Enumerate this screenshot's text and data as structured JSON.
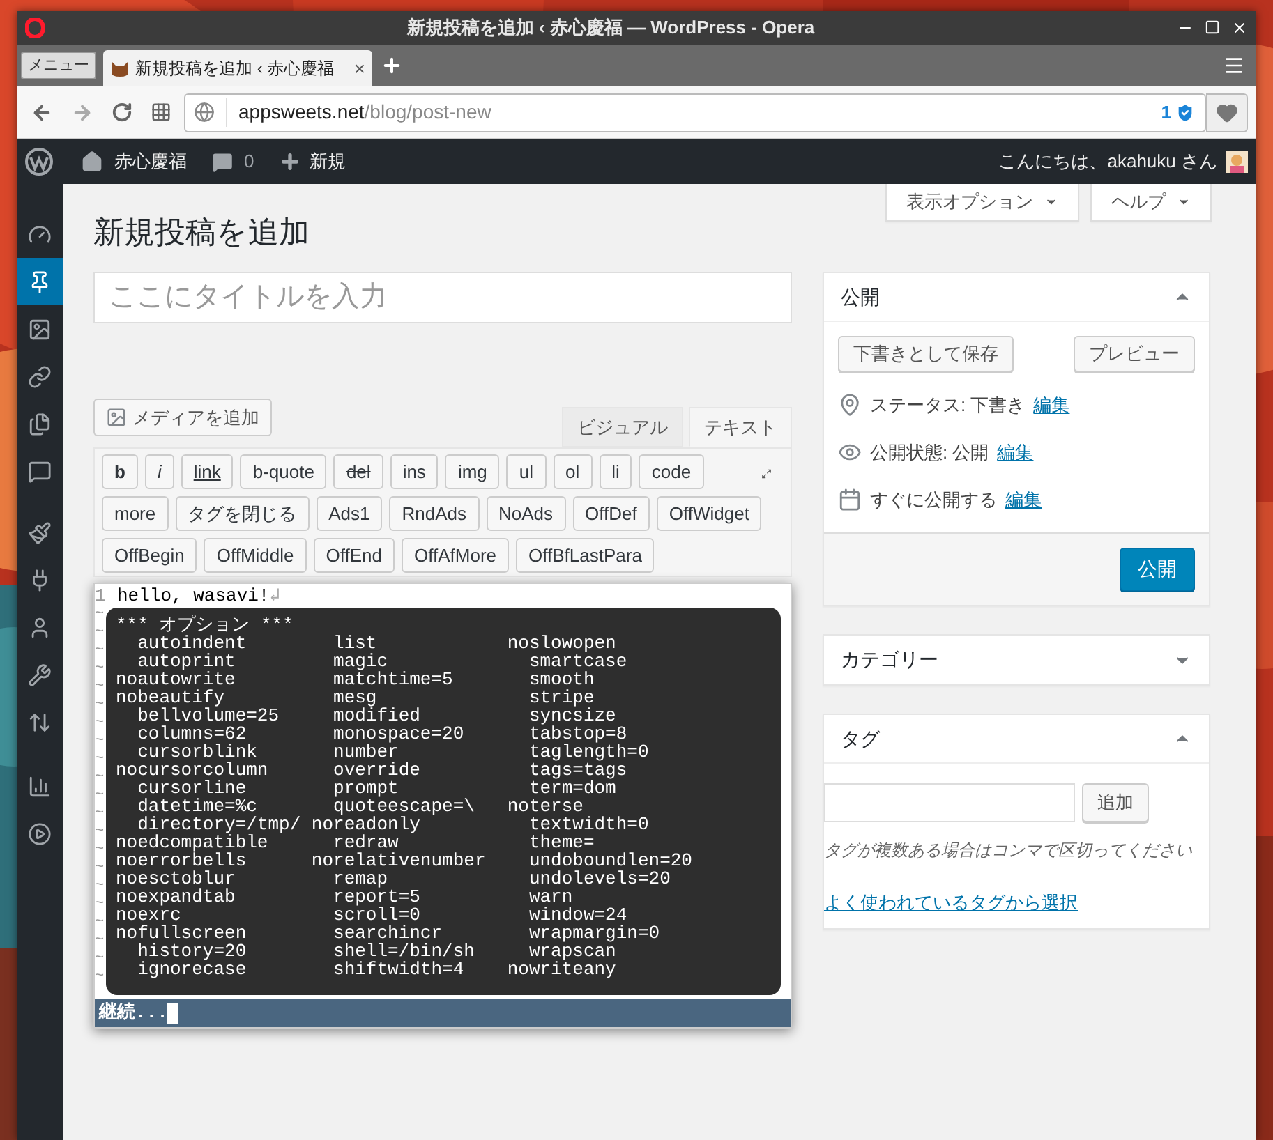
{
  "window": {
    "title": "新規投稿を追加 ‹ 赤心慶福 — WordPress - Opera"
  },
  "browser": {
    "menu_button": "メニュー",
    "tab": {
      "title": "新規投稿を追加 ‹ 赤心慶福",
      "close": "×",
      "selected": true
    },
    "address": {
      "host": "appsweets.net",
      "path": "/blog/post-new",
      "blocked_count": "1"
    }
  },
  "admin_bar": {
    "site": "赤心慶福",
    "comments": "0",
    "new": "新規",
    "greeting": "こんにちは、akahuku さん"
  },
  "admin_menu": [
    {
      "kind": "dashboard",
      "selected": false
    },
    {
      "kind": "posts",
      "selected": true
    },
    {
      "kind": "media",
      "selected": false
    },
    {
      "kind": "links",
      "selected": false
    },
    {
      "kind": "pages",
      "selected": false
    },
    {
      "kind": "comments",
      "selected": false
    },
    {
      "kind": "appearance",
      "selected": false
    },
    {
      "kind": "plugins",
      "selected": false
    },
    {
      "kind": "users",
      "selected": false
    },
    {
      "kind": "tools",
      "selected": false
    },
    {
      "kind": "settings",
      "selected": false
    },
    {
      "kind": "stats",
      "selected": false
    },
    {
      "kind": "video",
      "selected": false
    }
  ],
  "screen_tabs": [
    {
      "label": "表示オプション",
      "expanded": false
    },
    {
      "label": "ヘルプ",
      "expanded": false
    }
  ],
  "heading": "新規投稿を追加",
  "title_field": {
    "placeholder": "ここにタイトルを入力"
  },
  "media_button": "メディアを追加",
  "editor_tabs": [
    {
      "label": "ビジュアル",
      "selected": false
    },
    {
      "label": "テキスト",
      "selected": true
    }
  ],
  "quicktags": [
    [
      {
        "label": "b",
        "kind": "bold"
      },
      {
        "label": "i",
        "kind": "italic"
      },
      {
        "label": "link",
        "kind": "underline"
      },
      {
        "label": "b-quote",
        "kind": "plain"
      },
      {
        "label": "del",
        "kind": "strike"
      },
      {
        "label": "ins",
        "kind": "plain"
      },
      {
        "label": "img",
        "kind": "plain"
      },
      {
        "label": "ul",
        "kind": "plain"
      },
      {
        "label": "ol",
        "kind": "plain"
      },
      {
        "label": "li",
        "kind": "plain"
      },
      {
        "label": "code",
        "kind": "plain"
      }
    ],
    [
      {
        "label": "more",
        "kind": "plain"
      },
      {
        "label": "タグを閉じる",
        "kind": "plain"
      },
      {
        "label": "Ads1",
        "kind": "plain"
      },
      {
        "label": "RndAds",
        "kind": "plain"
      },
      {
        "label": "NoAds",
        "kind": "plain"
      },
      {
        "label": "OffDef",
        "kind": "plain"
      },
      {
        "label": "OffWidget",
        "kind": "plain"
      }
    ],
    [
      {
        "label": "OffBegin",
        "kind": "plain"
      },
      {
        "label": "OffMiddle",
        "kind": "plain"
      },
      {
        "label": "OffEnd",
        "kind": "plain"
      },
      {
        "label": "OffAfMore",
        "kind": "plain"
      },
      {
        "label": "OffBfLastPara",
        "kind": "plain"
      }
    ]
  ],
  "vi_editor": {
    "line_number": "1",
    "first_line": "hello, wasavi!",
    "eol_mark": "↲",
    "tildes": [
      "~",
      "~",
      "~",
      "~",
      "~",
      "~",
      "~",
      "~",
      "~",
      "~",
      "~",
      "~",
      "~",
      "~",
      "~",
      "~",
      "~",
      "~",
      "~",
      "~",
      "~"
    ],
    "options_lines": [
      "*** オプション ***",
      "  autoindent        list            noslowopen",
      "  autoprint         magic             smartcase",
      "noautowrite         matchtime=5       smooth",
      "nobeautify          mesg              stripe",
      "  bellvolume=25     modified          syncsize",
      "  columns=62        monospace=20      tabstop=8",
      "  cursorblink       number            taglength=0",
      "nocursorcolumn      override          tags=tags",
      "  cursorline        prompt            term=dom",
      "  datetime=%c       quoteescape=\\   noterse",
      "  directory=/tmp/ noreadonly          textwidth=0",
      "noedcompatible      redraw            theme=",
      "noerrorbells      norelativenumber    undoboundlen=20",
      "noesctoblur         remap             undolevels=20",
      "noexpandtab         report=5          warn",
      "noexrc              scroll=0          window=24",
      "nofullscreen        searchincr        wrapmargin=0",
      "  history=20        shell=/bin/sh     wrapscan",
      "  ignorecase        shiftwidth=4    nowriteany"
    ],
    "status": "継続..."
  },
  "publish_box": {
    "title": "公開",
    "expanded": true,
    "save_draft": "下書きとして保存",
    "preview": "プレビュー",
    "rows": [
      {
        "kind": "status",
        "text": "ステータス: 下書き",
        "link": "編集"
      },
      {
        "kind": "visibility",
        "text": "公開状態: 公開",
        "link": "編集"
      },
      {
        "kind": "schedule",
        "text": "すぐに公開する",
        "link": "編集"
      }
    ],
    "publish": "公開"
  },
  "category_box": {
    "title": "カテゴリー",
    "expanded": false
  },
  "tag_box": {
    "title": "タグ",
    "expanded": true,
    "add": "追加",
    "hint": "タグが複数ある場合はコンマで区切ってください",
    "link": "よく使われているタグから選択"
  }
}
